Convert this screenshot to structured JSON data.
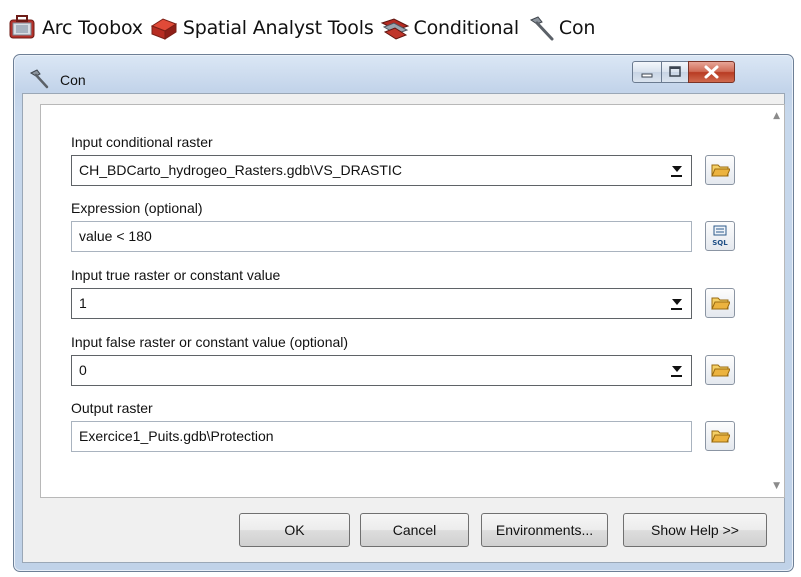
{
  "breadcrumb": [
    {
      "label": "Arc Toobox",
      "icon": "toolbox-icon"
    },
    {
      "label": "Spatial Analyst Tools",
      "icon": "toolbox-icon"
    },
    {
      "label": "Conditional",
      "icon": "toolset-icon"
    },
    {
      "label": "Con",
      "icon": "hammer-icon"
    }
  ],
  "window": {
    "title": "Con",
    "controls": [
      "minimize-icon",
      "maximize-icon",
      "close-icon"
    ]
  },
  "form": {
    "input_conditional_raster": {
      "label": "Input conditional raster",
      "value": "CH_BDCarto_hydrogeo_Rasters.gdb\\VS_DRASTIC"
    },
    "expression": {
      "label": "Expression (optional)",
      "value": "value < 180"
    },
    "input_true": {
      "label": "Input true raster or constant value",
      "value": "1"
    },
    "input_false": {
      "label": "Input false raster or constant value (optional)",
      "value": "0"
    },
    "output_raster": {
      "label": "Output raster",
      "value": "Exercice1_Puits.gdb\\Protection"
    }
  },
  "buttons": {
    "ok": "OK",
    "cancel": "Cancel",
    "environments": "Environments...",
    "show_help": "Show Help >>"
  },
  "sql_button_text": "SQL",
  "colors": {
    "window_frame": "#c3d4ea",
    "close_button": "#c94f36",
    "folder": "#e9b94a"
  }
}
